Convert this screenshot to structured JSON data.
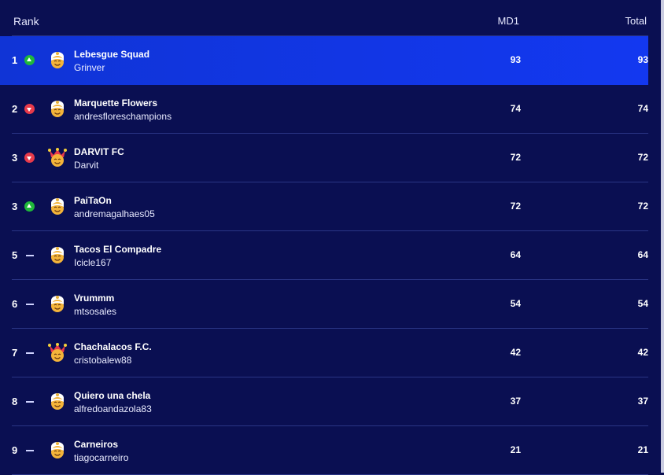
{
  "header": {
    "rank": "Rank",
    "md1": "MD1",
    "total": "Total"
  },
  "colors": {
    "background": "#0a0f52",
    "highlight": "#1338f0",
    "up": "#1fb83a",
    "down": "#e83a4a"
  },
  "rows": [
    {
      "rank": "1",
      "movement": "up",
      "avatar": "captain-avatar-icon",
      "team": "Lebesgue Squad",
      "manager": "Grinver",
      "md1": "93",
      "total": "93",
      "highlighted": true
    },
    {
      "rank": "2",
      "movement": "down",
      "avatar": "captain-avatar-icon",
      "team": "Marquette Flowers",
      "manager": "andresfloreschampions",
      "md1": "74",
      "total": "74"
    },
    {
      "rank": "3",
      "movement": "down",
      "avatar": "jester-avatar-icon",
      "team": "DARVIT FC",
      "manager": "Darvit",
      "md1": "72",
      "total": "72"
    },
    {
      "rank": "3",
      "movement": "up",
      "avatar": "captain-avatar-icon",
      "team": "PaiTaOn",
      "manager": "andremagalhaes05",
      "md1": "72",
      "total": "72"
    },
    {
      "rank": "5",
      "movement": "same",
      "avatar": "captain-avatar-icon",
      "team": "Tacos El Compadre",
      "manager": "Icicle167",
      "md1": "64",
      "total": "64"
    },
    {
      "rank": "6",
      "movement": "same",
      "avatar": "captain-avatar-icon",
      "team": "Vrummm",
      "manager": "mtsosales",
      "md1": "54",
      "total": "54"
    },
    {
      "rank": "7",
      "movement": "same",
      "avatar": "jester-avatar-icon",
      "team": "Chachalacos F.C.",
      "manager": "cristobalew88",
      "md1": "42",
      "total": "42"
    },
    {
      "rank": "8",
      "movement": "same",
      "avatar": "captain-avatar-icon",
      "team": "Quiero una chela",
      "manager": "alfredoandazola83",
      "md1": "37",
      "total": "37"
    },
    {
      "rank": "9",
      "movement": "same",
      "avatar": "captain-avatar-icon",
      "team": "Carneiros",
      "manager": "tiagocarneiro",
      "md1": "21",
      "total": "21"
    }
  ]
}
